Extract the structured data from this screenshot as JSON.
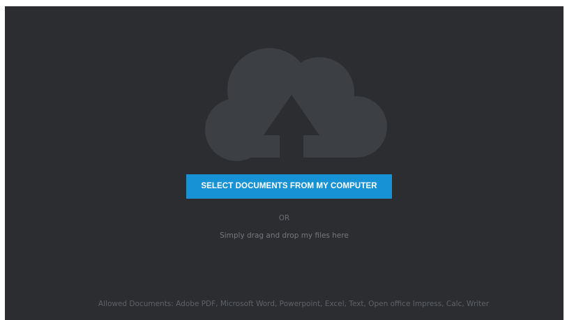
{
  "upload": {
    "select_button_label": "SELECT DOCUMENTS FROM MY COMPUTER",
    "or_label": "OR",
    "drag_hint": "Simply drag and drop my files here",
    "allowed_documents": "Allowed Documents: Adobe PDF, Microsoft Word, Powerpoint, Excel, Text, Open office Impress, Calc, Writer",
    "icon": "cloud-upload-icon"
  },
  "colors": {
    "panel_background": "#2b2d30",
    "cloud": "#3c3f43",
    "button": "#1792d4",
    "button_text": "#ffffff",
    "muted_text": "#6b6e73"
  }
}
